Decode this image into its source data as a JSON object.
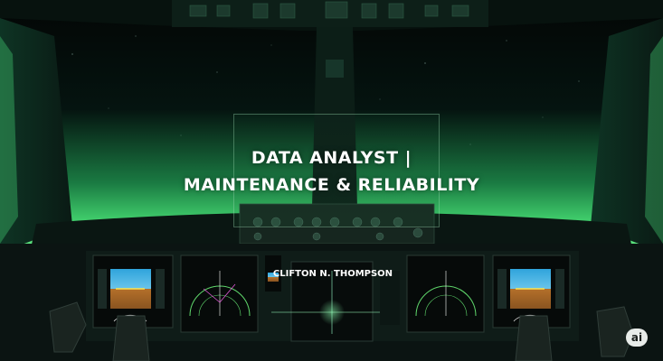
{
  "title": {
    "line1": "DATA ANALYST |",
    "line2": "MAINTENANCE & RELIABILITY"
  },
  "name": "CLIFTON N. THOMPSON",
  "badge": "ai",
  "colors": {
    "sky_top": "#040807",
    "horizon_glow": "#39d66e",
    "panel_dark": "#0b1412",
    "display_sky": "#2fa4dc",
    "display_ground": "#b4702a",
    "display_green": "#5fd66b"
  },
  "icons": [
    "cockpit-scene",
    "primary-flight-display",
    "navigation-display",
    "engine-display"
  ]
}
